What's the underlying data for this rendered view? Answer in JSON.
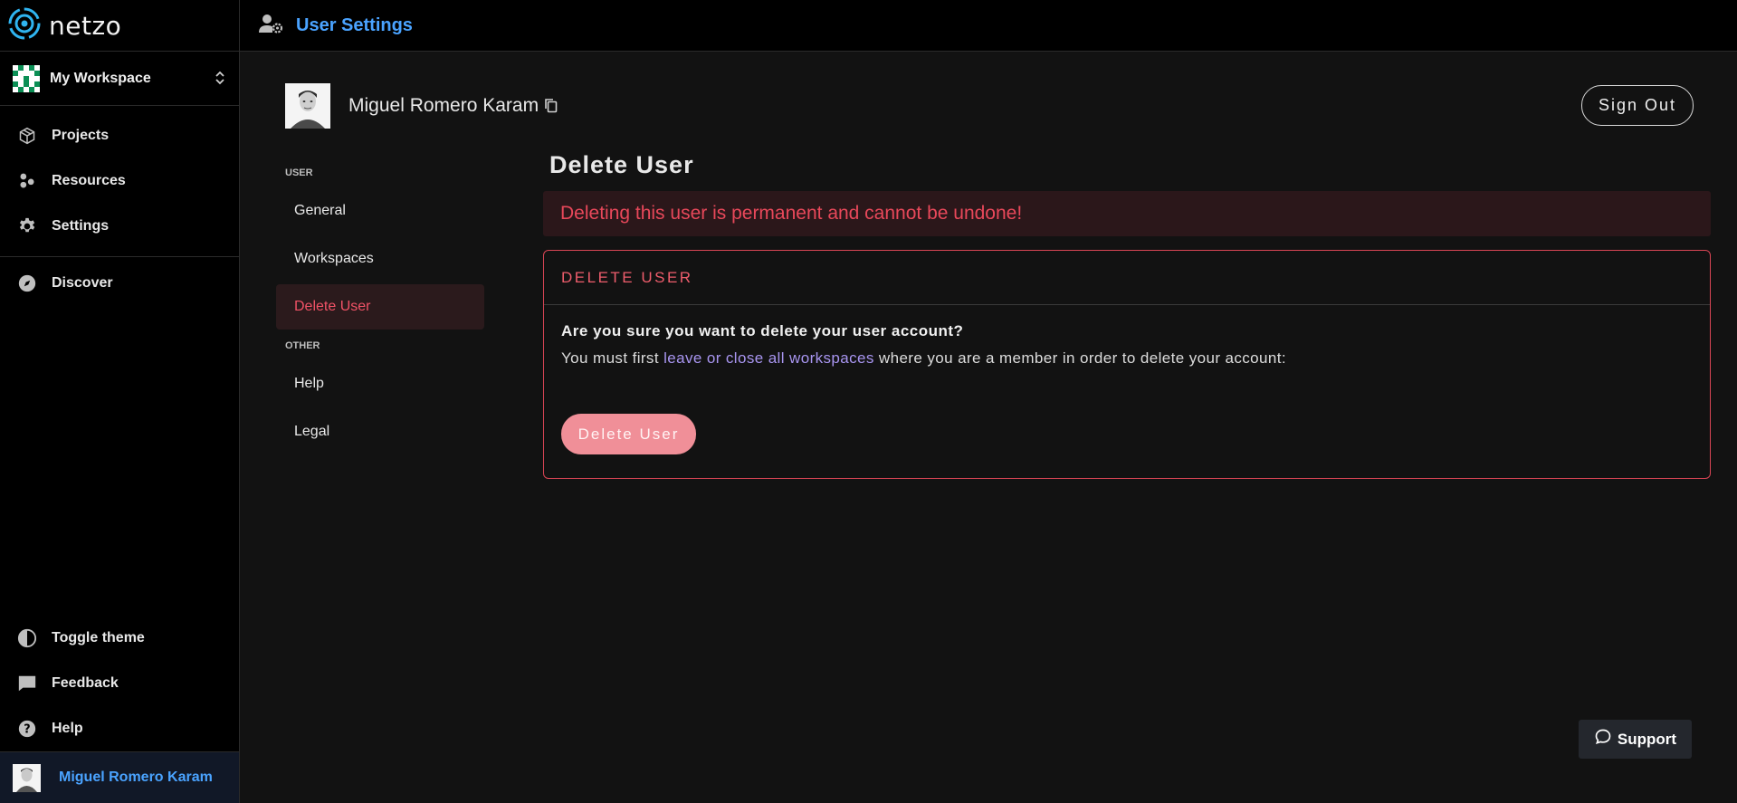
{
  "app": {
    "logo_text": "netzo"
  },
  "workspace": {
    "name": "My Workspace"
  },
  "sidebar": {
    "nav": [
      {
        "label": "Projects",
        "icon": "box-icon"
      },
      {
        "label": "Resources",
        "icon": "resources-icon"
      },
      {
        "label": "Settings",
        "icon": "gear-icon"
      }
    ],
    "discover": {
      "label": "Discover",
      "icon": "compass-icon"
    },
    "bottom": [
      {
        "label": "Toggle theme",
        "icon": "contrast-icon"
      },
      {
        "label": "Feedback",
        "icon": "message-icon"
      },
      {
        "label": "Help",
        "icon": "help-circle-icon"
      }
    ],
    "user": {
      "label": "Miguel Romero Karam"
    }
  },
  "header": {
    "title": "User Settings"
  },
  "profile": {
    "name": "Miguel Romero Karam",
    "sign_out_label": "Sign Out"
  },
  "subnav": {
    "user_section": "USER",
    "user_items": [
      "General",
      "Workspaces",
      "Delete User"
    ],
    "active_item": "Delete User",
    "other_section": "OTHER",
    "other_items": [
      "Help",
      "Legal"
    ]
  },
  "panel": {
    "title": "Delete User",
    "alert": "Deleting this user is permanent and cannot be undone!",
    "card_heading": "DELETE USER",
    "question": "Are you sure you want to delete your user account?",
    "text_before": "You must first",
    "text_link": "leave or close all workspaces",
    "text_after": "where you are a member in order to delete your account:",
    "delete_button_label": "Delete User"
  },
  "support": {
    "label": "Support"
  },
  "colors": {
    "accent_blue": "#4aa3ff",
    "danger": "#e8485a",
    "danger_button": "#f08f98",
    "link_purple": "#a895f0",
    "workspace_green": "#0b8f55"
  }
}
